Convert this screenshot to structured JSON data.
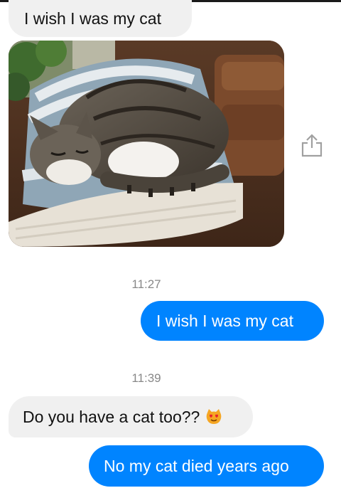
{
  "messages": [
    {
      "direction": "incoming",
      "text": "I wish I was my cat"
    },
    {
      "direction": "outgoing",
      "text": "I wish I was my cat"
    },
    {
      "direction": "incoming",
      "text": "Do you have a cat too??",
      "emoji": "heart-eyes-cat-emoji"
    },
    {
      "direction": "outgoing",
      "text": "No my cat died years ago"
    }
  ],
  "timestamps": [
    "11:27",
    "11:39"
  ],
  "attachment": {
    "type": "photo",
    "icons": {
      "share": "share-icon"
    }
  },
  "colors": {
    "outgoing_bubble": "#0084ff",
    "incoming_bubble": "#f0f0f0",
    "timestamp": "#888888",
    "share_icon": "#a0a0a0"
  }
}
